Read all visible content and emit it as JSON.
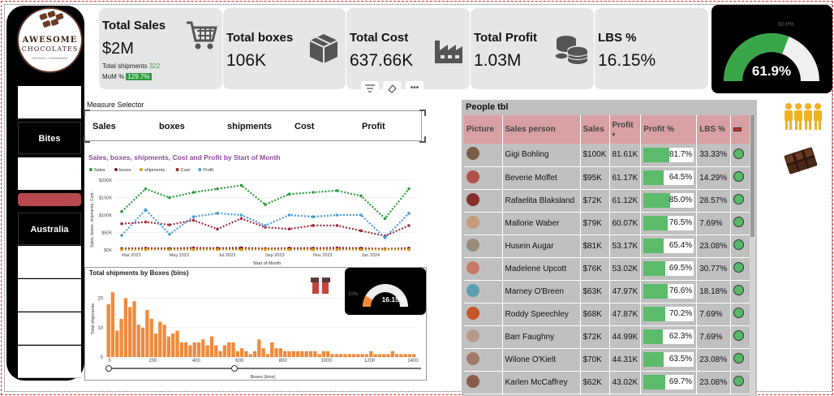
{
  "brand": {
    "name_line1": "AWESOME",
    "name_line2": "CHOCOLATES",
    "tagline": "ORGANIC • HANDMADE"
  },
  "sidebar": {
    "filter1": "Bites",
    "filter2": "Australia"
  },
  "kpis": {
    "sales": {
      "title": "Total Sales",
      "value": "$2M",
      "shipments_label": "Total shipments",
      "shipments_value": "322",
      "mom_label": "MoM %",
      "mom_value": "129.7%"
    },
    "boxes": {
      "title": "Total boxes",
      "value": "106K"
    },
    "cost": {
      "title": "Total Cost",
      "value": "637.66K"
    },
    "profit": {
      "title": "Total Profit",
      "value": "1.03M"
    },
    "lbs": {
      "title": "LBS %",
      "value": "16.15%"
    }
  },
  "gauge_main": {
    "value_pct": 61.9,
    "label": "61.9%",
    "target_label": "60.0%"
  },
  "toolbar": {
    "filter_icon": "filter-icon",
    "eraser_icon": "eraser-icon",
    "more_label": "•••"
  },
  "measure_selector": {
    "label": "Measure Selector",
    "options": [
      "Sales",
      "boxes",
      "shipments",
      "Cost",
      "Profit"
    ]
  },
  "colors": {
    "sales": "#2e9b3e",
    "boxes": "#8e1b2b",
    "shipments": "#d49b1f",
    "cost": "#9c2e3e",
    "profit": "#4a9bd4",
    "bars": "#f08a3a",
    "accent_green": "#3aa64a"
  },
  "chart_data": [
    {
      "type": "line",
      "title": "Sales, boxes, shipments, Cost and Profit by Start of Month",
      "xlabel": "Start of Month",
      "ylabel": "Sales, boxes, shipments, Cost...",
      "x_ticks": [
        "Mar 2023",
        "May 2023",
        "Jul 2023",
        "Sep 2023",
        "Nov 2023",
        "Jan 2024"
      ],
      "y_ticks": [
        "$0K",
        "$50K",
        "$100K",
        "$150K",
        "$200K"
      ],
      "ylim": [
        0,
        200
      ],
      "legend_position": "top-left",
      "series": [
        {
          "name": "Sales",
          "values": [
            110,
            175,
            150,
            165,
            175,
            185,
            130,
            160,
            165,
            170,
            155,
            90,
            175
          ]
        },
        {
          "name": "boxes",
          "values": [
            4,
            5,
            4,
            6,
            5,
            6,
            4,
            5,
            5,
            6,
            5,
            3,
            5
          ]
        },
        {
          "name": "shipments",
          "values": [
            1,
            1,
            1,
            1,
            1,
            1,
            1,
            1,
            1,
            1,
            1,
            1,
            1
          ]
        },
        {
          "name": "Cost",
          "values": [
            75,
            80,
            72,
            85,
            60,
            90,
            65,
            60,
            70,
            70,
            55,
            40,
            70
          ]
        },
        {
          "name": "Profit",
          "values": [
            42,
            115,
            45,
            95,
            105,
            100,
            70,
            100,
            95,
            100,
            100,
            35,
            105
          ]
        }
      ]
    },
    {
      "type": "bar",
      "title": "Total shipments by Boxes (bins)",
      "xlabel": "Boxes (bins)",
      "ylabel": "Total shipments",
      "x_ticks": [
        "0",
        "200",
        "400",
        "600",
        "800",
        "1000",
        "1200",
        "1400"
      ],
      "y_ticks": [
        "0",
        "10",
        "20"
      ],
      "ylim": [
        0,
        24
      ],
      "values": [
        18,
        22,
        9,
        13,
        20,
        17,
        19,
        11,
        10,
        16,
        13,
        8,
        12,
        11,
        7,
        8,
        9,
        5,
        5,
        4,
        5,
        5,
        6,
        4,
        7,
        4,
        2,
        4,
        5,
        5,
        2,
        3,
        2,
        1,
        2,
        6,
        3,
        1,
        5,
        3,
        3,
        2,
        2,
        2,
        2,
        2,
        2,
        2,
        2,
        1,
        2,
        2,
        1,
        1,
        1,
        1,
        1,
        1,
        1,
        1,
        1,
        2,
        1,
        1,
        1,
        1,
        2,
        1,
        1,
        1,
        1,
        1
      ]
    }
  ],
  "mini_gauge": {
    "value_pct": 16.15,
    "label": "16.15%",
    "target_label": "10%"
  },
  "people": {
    "title": "People tbl",
    "headers": [
      "Picture",
      "Sales person",
      "Sales",
      "Profit",
      "Profit %",
      "LBS %"
    ],
    "rows": [
      {
        "name": "Gigi Bohling",
        "sales": "$100K",
        "profit": "81.61K",
        "pct": "81.7%",
        "pct_val": 81.7,
        "lbs": "33.33%",
        "color": "#7a5c4a"
      },
      {
        "name": "Beverie Moffet",
        "sales": "$95K",
        "profit": "61.17K",
        "pct": "64.5%",
        "pct_val": 64.5,
        "lbs": "14.29%",
        "color": "#b0504a"
      },
      {
        "name": "Rafaelita Blaksland",
        "sales": "$72K",
        "profit": "61.12K",
        "pct": "85.0%",
        "pct_val": 85.0,
        "lbs": "28.57%",
        "color": "#8a2d2d"
      },
      {
        "name": "Mallorie Waber",
        "sales": "$79K",
        "profit": "60.07K",
        "pct": "76.5%",
        "pct_val": 76.5,
        "lbs": "7.69%",
        "color": "#c79a7a"
      },
      {
        "name": "Husein Augar",
        "sales": "$81K",
        "profit": "53.17K",
        "pct": "65.4%",
        "pct_val": 65.4,
        "lbs": "23.08%",
        "color": "#9a8a7a"
      },
      {
        "name": "Madelene Upcott",
        "sales": "$76K",
        "profit": "53.02K",
        "pct": "69.5%",
        "pct_val": 69.5,
        "lbs": "30.77%",
        "color": "#c77a6a"
      },
      {
        "name": "Marney O'Breen",
        "sales": "$63K",
        "profit": "47.97K",
        "pct": "76.6%",
        "pct_val": 76.6,
        "lbs": "18.18%",
        "color": "#5aa0b0"
      },
      {
        "name": "Roddy Speechley",
        "sales": "$68K",
        "profit": "47.87K",
        "pct": "70.2%",
        "pct_val": 70.2,
        "lbs": "7.69%",
        "color": "#c8542a"
      },
      {
        "name": "Barr Faughny",
        "sales": "$72K",
        "profit": "44.99K",
        "pct": "62.3%",
        "pct_val": 62.3,
        "lbs": "7.69%",
        "color": "#b89a8a"
      },
      {
        "name": "Wilone O'Kielt",
        "sales": "$70K",
        "profit": "44.31K",
        "pct": "63.5%",
        "pct_val": 63.5,
        "lbs": "23.08%",
        "color": "#a07a6a"
      },
      {
        "name": "Karlen McCaffrey",
        "sales": "$62K",
        "profit": "43.02K",
        "pct": "69.7%",
        "pct_val": 69.7,
        "lbs": "23.08%",
        "color": "#8a5a4a"
      }
    ]
  },
  "side_icons": {
    "people_icon": "people-group-icon",
    "chocolate_icon": "chocolate-bar-icon"
  }
}
